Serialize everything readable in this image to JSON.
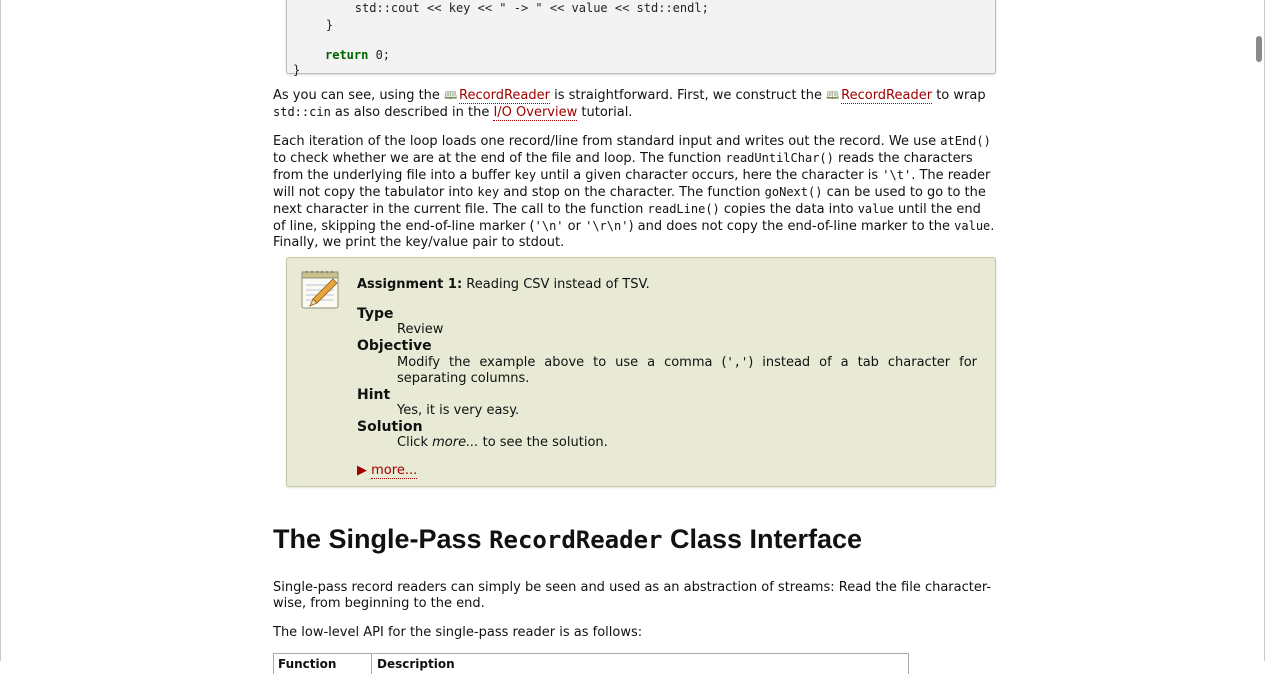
{
  "code": {
    "line_top": "        std::cout << key << \" -> \" << value << std::endl;",
    "line_close_inner": "    }",
    "return_kw": "return",
    "return_rest": " 0;",
    "line_close_outer": "}"
  },
  "para1": {
    "t1": "As you can see, using the ",
    "link1": "RecordReader",
    "t2": " is straightforward. First, we construct the ",
    "link2": "RecordReader",
    "t3": " to wrap ",
    "code1": "std::cin",
    "t4": " as also described in the ",
    "link3": "I/O Overview",
    "t5": " tutorial."
  },
  "para2": {
    "t1": "Each iteration of the loop loads one record/line from standard input and writes out the record. We use ",
    "c1": "atEnd()",
    "t2": " to check whether we are at the end of the file and loop. The function ",
    "c2": "readUntilChar()",
    "t3": " reads the characters from the underlying file into a buffer ",
    "c3": "key",
    "t4": " until a given character occurs, here the character is ",
    "c4": "'\\t'",
    "t5": ". The reader will not copy the tabulator into ",
    "c5": "key",
    "t6": " and stop on the character. The function ",
    "c6": "goNext()",
    "t7": " can be used to go to the next character in the current file. The call to the function ",
    "c7": "readLine()",
    "t8": " copies the data into ",
    "c8": "value",
    "t9": " until the end of line, skipping the end-of-line marker (",
    "c9": "'\\n'",
    "t10": " or ",
    "c10": "'\\r\\n'",
    "t11": ") and does not copy the end-of-line marker to the ",
    "c11": "value",
    "t12": ". Finally, we print the key/value pair to stdout."
  },
  "assignment": {
    "title_bold": "Assignment 1:",
    "title_rest": " Reading CSV instead of TSV.",
    "type_label": "Type",
    "type_value": "Review",
    "objective_label": "Objective",
    "objective_value_a": "Modify the example above to use a comma (",
    "objective_value_code": "','",
    "objective_value_b": ") instead of a tab character for separating columns.",
    "hint_label": "Hint",
    "hint_value": "Yes, it is very easy.",
    "solution_label": "Solution",
    "solution_a": "Click ",
    "solution_em": "more...",
    "solution_b": " to see the solution.",
    "more_arrow": "▶",
    "more_label": "more..."
  },
  "section": {
    "heading_a": "The Single-Pass ",
    "heading_code": "RecordReader",
    "heading_b": " Class Interface"
  },
  "para3": "Single-pass record readers can simply be seen and used as an abstraction of streams: Read the file character-wise, from beginning to the end.",
  "para4": "The low-level API for the single-pass reader is as follows:",
  "table": {
    "col1": "Function",
    "col2": "Description"
  }
}
